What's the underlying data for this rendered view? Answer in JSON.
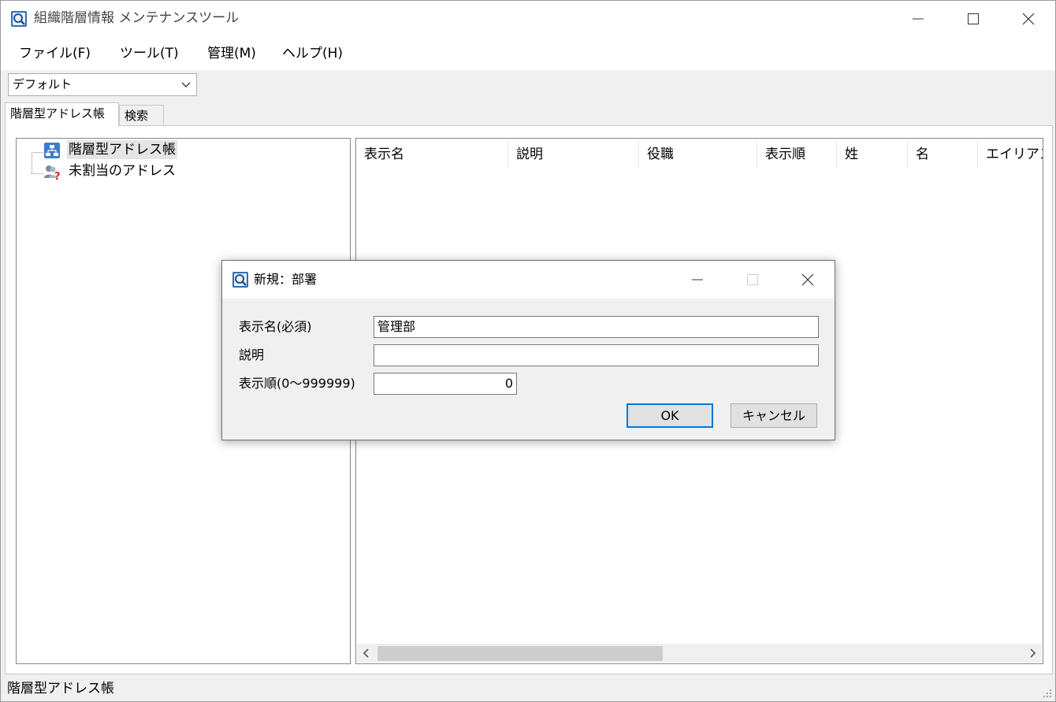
{
  "window": {
    "title": "組織階層情報 メンテナンスツール",
    "icon": "magnifier-app-icon"
  },
  "menu": {
    "items": [
      {
        "label": "ファイル(F)"
      },
      {
        "label": "ツール(T)"
      },
      {
        "label": "管理(M)"
      },
      {
        "label": "ヘルプ(H)"
      }
    ]
  },
  "profile_combo": {
    "value": "デフォルト"
  },
  "tabs": [
    {
      "label": "階層型アドレス帳",
      "active": true
    },
    {
      "label": "検索",
      "active": false
    }
  ],
  "tree": {
    "items": [
      {
        "label": "階層型アドレス帳",
        "icon": "hierarchy-icon",
        "selected": true
      },
      {
        "label": "未割当のアドレス",
        "icon": "unassigned-users-icon",
        "selected": false
      }
    ]
  },
  "list": {
    "columns": [
      {
        "label": "表示名"
      },
      {
        "label": "説明"
      },
      {
        "label": "役職"
      },
      {
        "label": "表示順"
      },
      {
        "label": "姓"
      },
      {
        "label": "名"
      },
      {
        "label": "エイリアス"
      }
    ]
  },
  "status": {
    "text": "階層型アドレス帳"
  },
  "dialog": {
    "title": "新規：部署",
    "fields": {
      "display_name": {
        "label": "表示名(必須)",
        "value": "管理部"
      },
      "description": {
        "label": "説明",
        "value": ""
      },
      "order": {
        "label": "表示順(0〜999999)",
        "value": "0"
      }
    },
    "ok_label": "OK",
    "cancel_label": "キャンセル"
  },
  "colors": {
    "accent": "#0078d7",
    "tree_selection": "#e5e5e5",
    "window_bg": "#f0f0f0"
  }
}
